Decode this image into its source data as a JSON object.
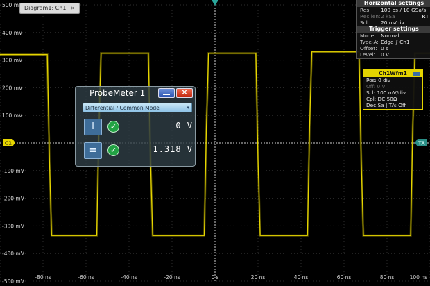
{
  "diagram_tab": {
    "label": "Diagram1: Ch1",
    "close": "×"
  },
  "y_axis": {
    "ticks": [
      "500 mV",
      "400 mV",
      "300 mV",
      "200 mV",
      "100 mV",
      "C1",
      "-100 mV",
      "-200 mV",
      "-300 mV",
      "-400 mV",
      "-500 mV"
    ]
  },
  "x_axis": {
    "ticks": [
      "-80 ns",
      "-60 ns",
      "-40 ns",
      "-20 ns",
      "0 s",
      "20 ns",
      "40 ns",
      "60 ns",
      "80 ns"
    ],
    "right_label": "100 ns"
  },
  "markers": {
    "left": "C1",
    "right": "TA"
  },
  "horizontal_settings": {
    "title": "Horizontal settings",
    "rt": "RT",
    "rows": [
      {
        "key": "Res:",
        "value": "100 ps / 10 GSa/s",
        "dim": false
      },
      {
        "key": "Rec len:",
        "value": "2 kSa",
        "dim": true
      },
      {
        "key": "Scl:",
        "value": "20 ns/div",
        "dim": false
      }
    ]
  },
  "trigger_settings": {
    "title": "Trigger settings",
    "rows": [
      {
        "key": "Mode:",
        "value": "Normal"
      },
      {
        "key": "Type-A:",
        "value": "Edge ⨍ Ch1"
      },
      {
        "key": "Offset:",
        "value": "0 s"
      },
      {
        "key": "Level:",
        "value": "0 V"
      }
    ]
  },
  "channel_panel": {
    "title": "Ch1Wfm1",
    "rows": [
      {
        "text": "Pos: 0 div",
        "dim": false
      },
      {
        "text": "Off: 0 V",
        "dim": true
      },
      {
        "text": "Scl: 100 mV/div",
        "dim": false
      },
      {
        "text": "Cpl: DC 50Ω",
        "dim": false
      },
      {
        "text": "Dec:Sa | TA: Off",
        "dim": false
      }
    ]
  },
  "probe_meter": {
    "title": "ProbeMeter 1",
    "close": "×",
    "mode": "Differential / Common Mode",
    "rows": [
      {
        "icon": "differential-icon",
        "glyph": "I",
        "value": "0  V"
      },
      {
        "icon": "common-mode-icon",
        "glyph": "≡",
        "value": "1.318  V"
      }
    ],
    "check": "✓"
  },
  "chart_data": {
    "type": "line",
    "title": "",
    "xlabel": "",
    "ylabel": "",
    "xlim": [
      -100,
      100
    ],
    "ylim": [
      -500,
      500
    ],
    "x_unit": "ns",
    "y_unit": "mV",
    "series": [
      {
        "color": "#e6d500",
        "x": [
          -100,
          -78,
          -77,
          -76,
          -55,
          -54,
          -53,
          -31,
          -30,
          -29,
          -5,
          -4,
          -3,
          19,
          20,
          21,
          43,
          44,
          45,
          67,
          68,
          69,
          91,
          92,
          93,
          100
        ],
        "y": [
          320,
          320,
          -60,
          -335,
          -335,
          50,
          325,
          325,
          -60,
          -335,
          -335,
          60,
          325,
          325,
          -60,
          -335,
          -335,
          60,
          330,
          330,
          -60,
          -335,
          -335,
          60,
          325,
          325
        ]
      }
    ],
    "grid": true,
    "colors": {
      "trace": "#e6d500",
      "grid": "#3a3a3a",
      "axis_text": "#d8d8d8"
    }
  }
}
